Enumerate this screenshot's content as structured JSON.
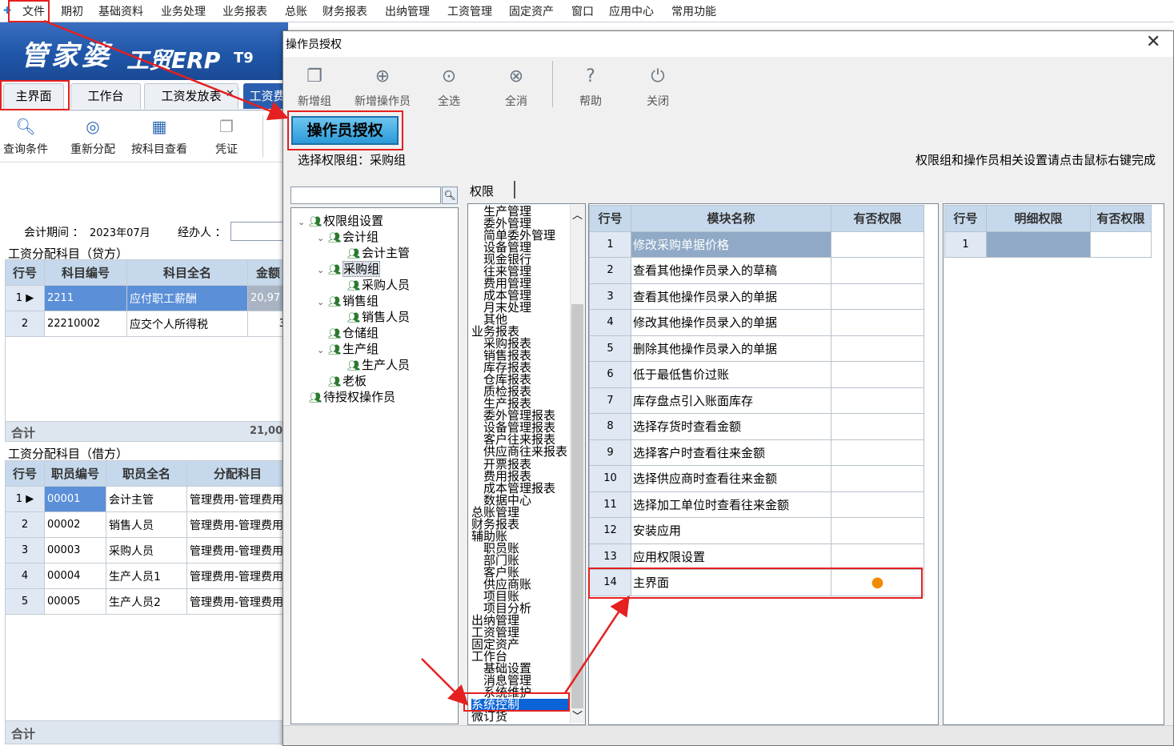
{
  "menu": [
    "文件",
    "期初",
    "基础资料",
    "业务处理",
    "业务报表",
    "总账",
    "财务报表",
    "出纳管理",
    "工资管理",
    "固定资产",
    "窗口",
    "应用中心",
    "常用功能"
  ],
  "brand": {
    "name": "管家婆",
    "product": "工贸ERP",
    "version": "T9"
  },
  "tabs": [
    "主界面",
    "工作台",
    "工资发放表",
    "工资费"
  ],
  "toolbar": [
    "查询条件",
    "重新分配",
    "按科目查看",
    "凭证"
  ],
  "period": {
    "label": "会计期间 ：",
    "value": "2023年07月",
    "handler_label": "经办人 ："
  },
  "credit": {
    "title": "工资分配科目（贷方）",
    "headers": [
      "行号",
      "科目编号",
      "科目全名",
      "金额"
    ],
    "rows": [
      {
        "n": "1",
        "code": "2211",
        "name": "应付职工薪酬",
        "amt": "20,97"
      },
      {
        "n": "2",
        "code": "22210002",
        "name": "应交个人所得税",
        "amt": "3"
      }
    ],
    "sum_label": "合计",
    "sum_value": "21,00"
  },
  "debit": {
    "title": "工资分配科目（借方）",
    "headers": [
      "行号",
      "职员编号",
      "职员全名",
      "分配科目"
    ],
    "rows": [
      {
        "n": "1",
        "code": "00001",
        "name": "会计主管",
        "acct": "管理费用-管理费用"
      },
      {
        "n": "2",
        "code": "00002",
        "name": "销售人员",
        "acct": "管理费用-管理费用"
      },
      {
        "n": "3",
        "code": "00003",
        "name": "采购人员",
        "acct": "管理费用-管理费用"
      },
      {
        "n": "4",
        "code": "00004",
        "name": "生产人员1",
        "acct": "管理费用-管理费用"
      },
      {
        "n": "5",
        "code": "00005",
        "name": "生产人员2",
        "acct": "管理费用-管理费用"
      }
    ],
    "sum_label": "合计"
  },
  "dialog": {
    "title": "操作员授权",
    "buttons": [
      "新增组",
      "新增操作员",
      "全选",
      "全消",
      "帮助",
      "关闭"
    ],
    "heading": "操作员授权",
    "group_label": "选择权限组：采购组",
    "hint": "权限组和操作员相关设置请点击鼠标右键完成",
    "perm_tab": "权限",
    "tree": [
      {
        "label": "权限组设置",
        "level": 0
      },
      {
        "label": "会计组",
        "level": 1
      },
      {
        "label": "会计主管",
        "level": 2
      },
      {
        "label": "采购组",
        "level": 1
      },
      {
        "label": "采购人员",
        "level": 2
      },
      {
        "label": "销售组",
        "level": 1
      },
      {
        "label": "销售人员",
        "level": 2
      },
      {
        "label": "仓储组",
        "level": 1
      },
      {
        "label": "生产组",
        "level": 1
      },
      {
        "label": "生产人员",
        "level": 2
      },
      {
        "label": "老板",
        "level": 1
      },
      {
        "label": "待授权操作员",
        "level": 0
      }
    ],
    "modules": [
      {
        "t": "生产管理",
        "l": 1
      },
      {
        "t": "委外管理",
        "l": 1
      },
      {
        "t": "简单委外管理",
        "l": 1
      },
      {
        "t": "设备管理",
        "l": 1
      },
      {
        "t": "现金银行",
        "l": 1
      },
      {
        "t": "往来管理",
        "l": 1
      },
      {
        "t": "费用管理",
        "l": 1
      },
      {
        "t": "成本管理",
        "l": 1
      },
      {
        "t": "月末处理",
        "l": 1
      },
      {
        "t": "其他",
        "l": 1
      },
      {
        "t": "业务报表",
        "l": 0
      },
      {
        "t": "采购报表",
        "l": 1
      },
      {
        "t": "销售报表",
        "l": 1
      },
      {
        "t": "库存报表",
        "l": 1
      },
      {
        "t": "仓库报表",
        "l": 1
      },
      {
        "t": "质检报表",
        "l": 1
      },
      {
        "t": "生产报表",
        "l": 1
      },
      {
        "t": "委外管理报表",
        "l": 1
      },
      {
        "t": "设备管理报表",
        "l": 1
      },
      {
        "t": "客户往来报表",
        "l": 1
      },
      {
        "t": "供应商往来报表",
        "l": 1
      },
      {
        "t": "开票报表",
        "l": 1
      },
      {
        "t": "费用报表",
        "l": 1
      },
      {
        "t": "成本管理报表",
        "l": 1
      },
      {
        "t": "数据中心",
        "l": 1
      },
      {
        "t": "总账管理",
        "l": 0
      },
      {
        "t": "财务报表",
        "l": 0
      },
      {
        "t": "辅助账",
        "l": 0
      },
      {
        "t": "职员账",
        "l": 1
      },
      {
        "t": "部门账",
        "l": 1
      },
      {
        "t": "客户账",
        "l": 1
      },
      {
        "t": "供应商账",
        "l": 1
      },
      {
        "t": "项目账",
        "l": 1
      },
      {
        "t": "项目分析",
        "l": 1
      },
      {
        "t": "出纳管理",
        "l": 0
      },
      {
        "t": "工资管理",
        "l": 0
      },
      {
        "t": "固定资产",
        "l": 0
      },
      {
        "t": "工作台",
        "l": 0
      },
      {
        "t": "基础设置",
        "l": 1
      },
      {
        "t": "消息管理",
        "l": 1
      },
      {
        "t": "系统维护",
        "l": 1
      },
      {
        "t": "系统控制",
        "l": 0,
        "sel": true
      },
      {
        "t": "微订货",
        "l": 0
      }
    ],
    "perm_headers": [
      "行号",
      "模块名称",
      "有否权限"
    ],
    "perms": [
      {
        "n": "1",
        "name": "修改采购单据价格",
        "has": ""
      },
      {
        "n": "2",
        "name": "查看其他操作员录入的草稿",
        "has": ""
      },
      {
        "n": "3",
        "name": "查看其他操作员录入的单据",
        "has": ""
      },
      {
        "n": "4",
        "name": "修改其他操作员录入的单据",
        "has": ""
      },
      {
        "n": "5",
        "name": "删除其他操作员录入的单据",
        "has": ""
      },
      {
        "n": "6",
        "name": "低于最低售价过账",
        "has": ""
      },
      {
        "n": "7",
        "name": "库存盘点引入账面库存",
        "has": ""
      },
      {
        "n": "8",
        "name": "选择存货时查看金额",
        "has": ""
      },
      {
        "n": "9",
        "name": "选择客户时查看往来金额",
        "has": ""
      },
      {
        "n": "10",
        "name": "选择供应商时查看往来金额",
        "has": ""
      },
      {
        "n": "11",
        "name": "选择加工单位时查看往来金额",
        "has": ""
      },
      {
        "n": "12",
        "name": "安装应用",
        "has": ""
      },
      {
        "n": "13",
        "name": "应用权限设置",
        "has": ""
      },
      {
        "n": "14",
        "name": "主界面",
        "has": "●"
      }
    ],
    "detail_headers": [
      "行号",
      "明细权限",
      "有否权限"
    ],
    "details": [
      {
        "n": "1",
        "name": "",
        "has": ""
      }
    ],
    "colors": {
      "granted_dot": "#f08a00",
      "selection": "#0a64d8",
      "highlight": "#e52020"
    }
  }
}
